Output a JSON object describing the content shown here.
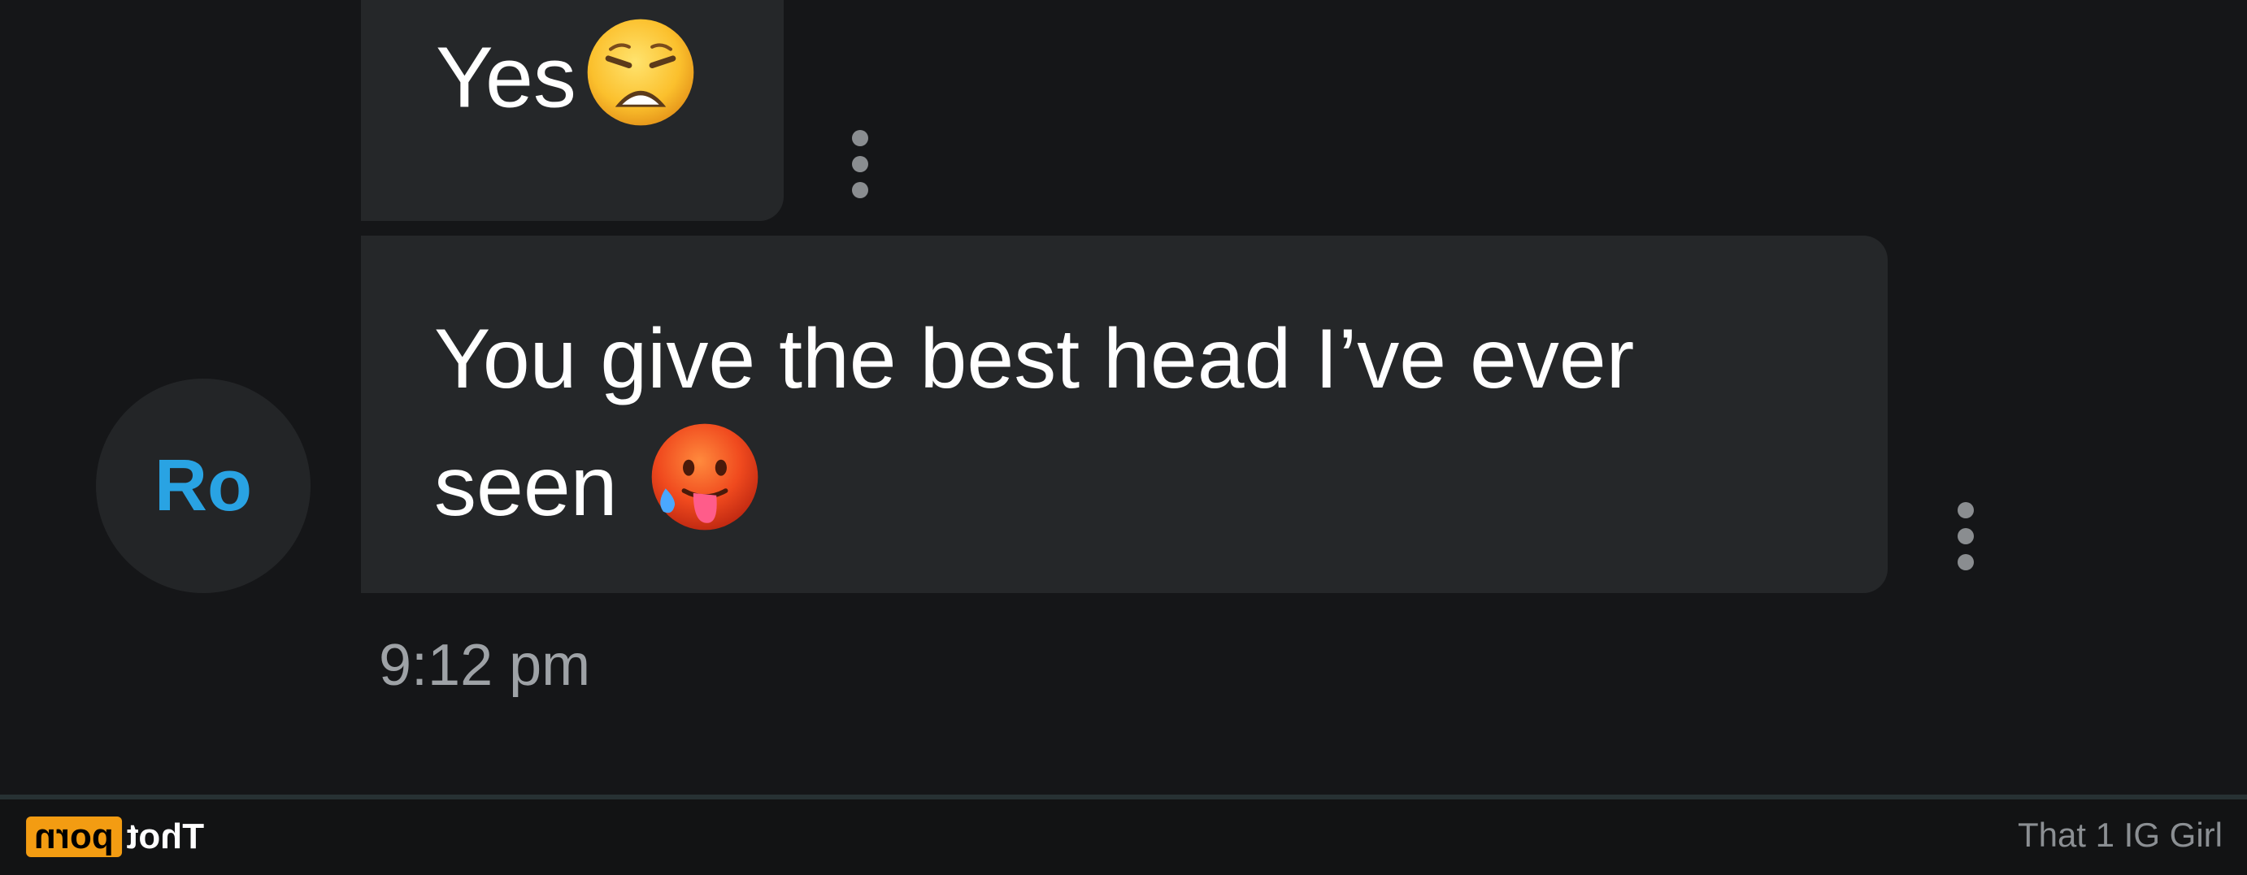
{
  "messages": [
    {
      "text": "Yes",
      "emoji": "weary-face"
    },
    {
      "text": "You give the best head I’ve ever seen",
      "emoji": "hot-face"
    }
  ],
  "avatar": {
    "initials": "Ro",
    "color": "#29a3e3"
  },
  "timestamp": "9:12 pm",
  "watermark": {
    "brand_part1": "Thot",
    "brand_part2": "porn",
    "accent": "#f39c12"
  },
  "caption": "That 1 IG Girl"
}
